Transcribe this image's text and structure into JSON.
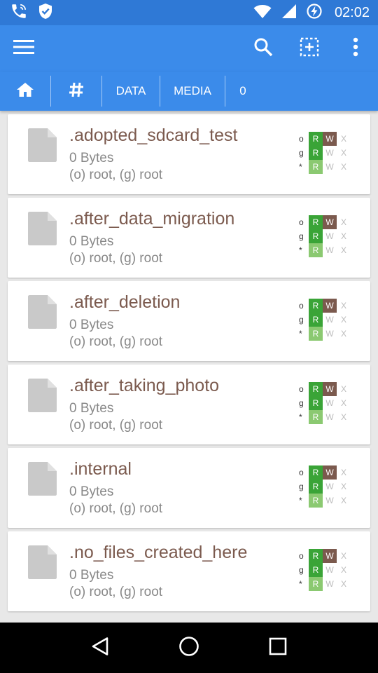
{
  "status_bar": {
    "time": "02:02"
  },
  "breadcrumbs": [
    {
      "label": "DATA"
    },
    {
      "label": "MEDIA"
    },
    {
      "label": "0"
    }
  ],
  "files": [
    {
      "name": ".adopted_sdcard_test",
      "size": "0 Bytes",
      "owner": "(o) root, (g) root"
    },
    {
      "name": ".after_data_migration",
      "size": "0 Bytes",
      "owner": "(o) root, (g) root"
    },
    {
      "name": ".after_deletion",
      "size": "0 Bytes",
      "owner": "(o) root, (g) root"
    },
    {
      "name": ".after_taking_photo",
      "size": "0 Bytes",
      "owner": "(o) root, (g) root"
    },
    {
      "name": ".internal",
      "size": "0 Bytes",
      "owner": "(o) root, (g) root"
    },
    {
      "name": ".no_files_created_here",
      "size": "0 Bytes",
      "owner": "(o) root, (g) root"
    }
  ],
  "permissions": {
    "row_labels": [
      "o",
      "g",
      "*"
    ],
    "r": "R",
    "w": "W",
    "x": "X"
  },
  "colors": {
    "status_bar": "#2f79d6",
    "toolbar": "#3b8bea",
    "file_name": "#7b5a4e",
    "perm_read": "#3aa437",
    "perm_read_light": "#8bc971",
    "perm_write": "#7b5a4e"
  },
  "icons": {
    "status_left": [
      "phone-wifi-icon",
      "shield-check-icon"
    ],
    "status_right": [
      "wifi-icon",
      "cell-signal-icon",
      "battery-charging-icon"
    ],
    "toolbar": [
      "menu-icon",
      "search-icon",
      "select-add-icon",
      "overflow-menu-icon"
    ],
    "breadcrumbs": [
      "home-icon",
      "hash-icon"
    ],
    "file": "file-icon",
    "nav": [
      "back-icon",
      "home-circle-icon",
      "recents-icon"
    ]
  }
}
